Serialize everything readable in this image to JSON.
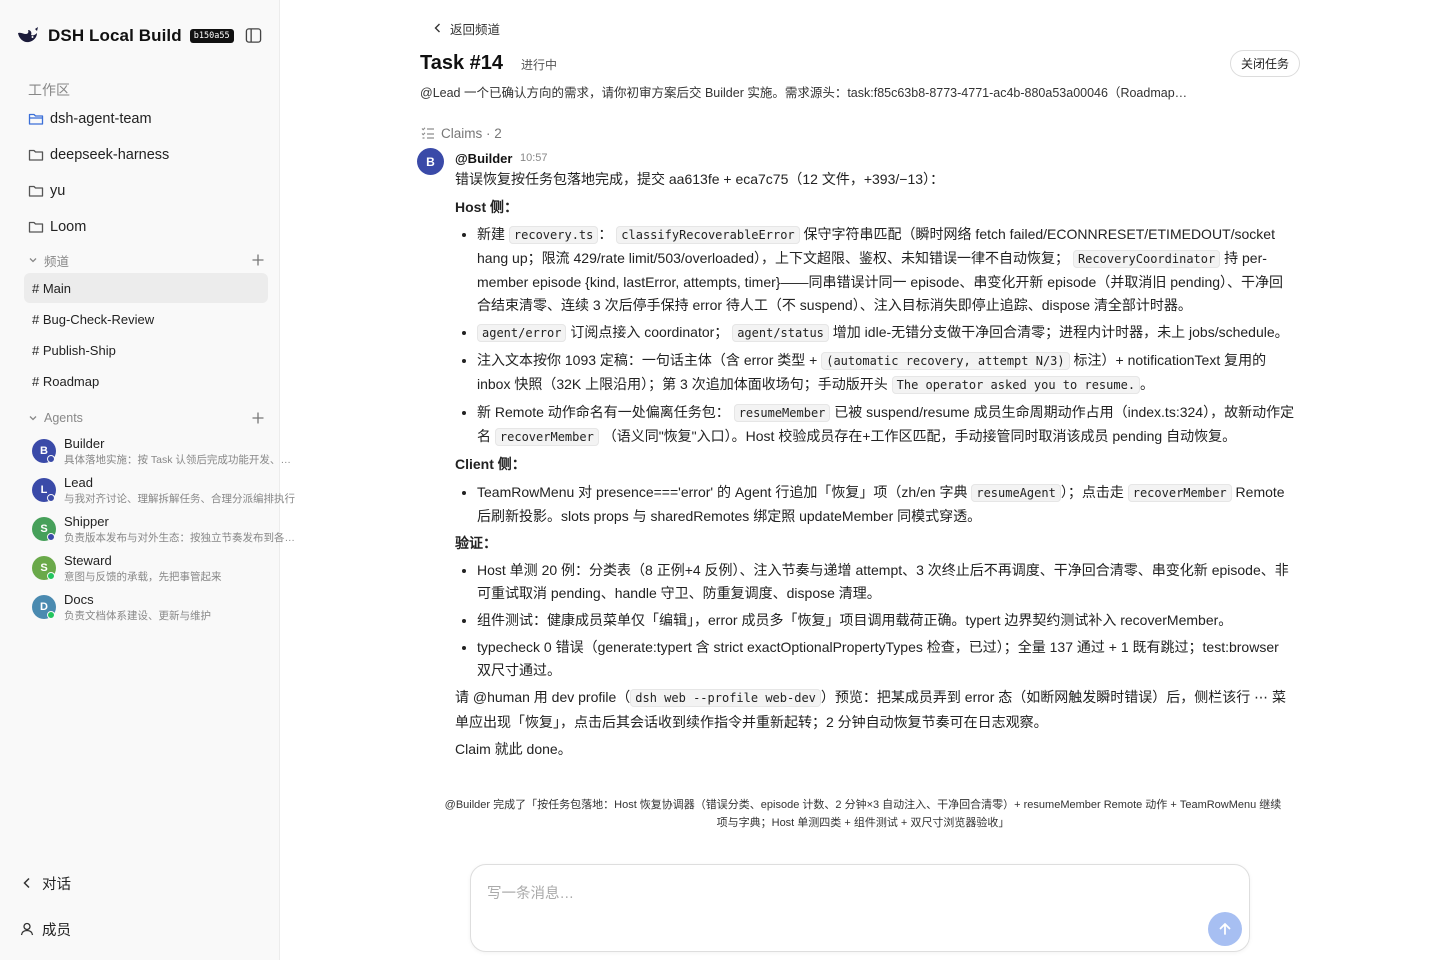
{
  "app": {
    "title": "DSH Local Build",
    "build": "b150a55"
  },
  "sidebar": {
    "workspace_label": "工作区",
    "workspaces": [
      {
        "label": "dsh-agent-team",
        "active": true
      },
      {
        "label": "deepseek-harness"
      },
      {
        "label": "yu"
      },
      {
        "label": "Loom"
      }
    ],
    "channels_label": "频道",
    "channels": [
      {
        "label": "# Main",
        "active": true
      },
      {
        "label": "# Bug-Check-Review"
      },
      {
        "label": "# Publish-Ship"
      },
      {
        "label": "# Roadmap"
      }
    ],
    "agents_label": "Agents",
    "agents": [
      {
        "name": "Builder",
        "initial": "B",
        "desc": "具体落地实施：按 Task 认领后完成功能开发、测试与提交",
        "color": "#3a4aa8"
      },
      {
        "name": "Lead",
        "initial": "L",
        "desc": "与我对齐讨论、理解拆解任务、合理分派编排执行",
        "color": "#3a4aa8"
      },
      {
        "name": "Shipper",
        "initial": "S",
        "desc": "负责版本发布与对外生态：按独立节奏发布到各渠道",
        "color": "#46a05a"
      },
      {
        "name": "Steward",
        "initial": "S",
        "desc": "意图与反馈的承载，先把事管起来",
        "color": "#6aa94a"
      },
      {
        "name": "Docs",
        "initial": "D",
        "desc": "负责文档体系建设、更新与维护",
        "color": "#4a8ab0"
      }
    ],
    "bottom": {
      "conversations": "对话",
      "members": "成员"
    }
  },
  "main": {
    "back_label": "返回频道",
    "task_title": "Task #14",
    "task_status": "进行中",
    "close_label": "关闭任务",
    "task_desc": "@Lead 一个已确认方向的需求，请你初审方案后交 Builder 实施。需求源头：task:f85c63b8-8773-4771-ac4b-880a53a00046（Roadmap…",
    "claims_label": "Claims · 2",
    "message": {
      "author": "@Builder",
      "initial": "B",
      "time": "10:57",
      "intro": "错误恢复按任务包落地完成，提交 aa613fe + eca7c75（12 文件，+393/−13）：",
      "host_heading": "Host 侧：",
      "host": {
        "b1_t1": "新建",
        "b1_c1": "recovery.ts",
        "b1_t2": "：",
        "b1_c2": "classifyRecoverableError",
        "b1_t3": "保守字符串匹配（瞬时网络 fetch failed/ECONNRESET/ETIMEDOUT/socket hang up；限流 429/rate limit/503/overloaded），上下文超限、鉴权、未知错误一律不自动恢复；",
        "b1_c3": "RecoveryCoordinator",
        "b1_t4": "持 per-member episode {kind, lastError, attempts, timer}——同串错误计同一 episode、串变化开新 episode（并取消旧 pending）、干净回合结束清零、连续 3 次后停手保持 error 待人工（不 suspend）、注入目标消失即停止追踪、dispose 清全部计时器。",
        "b2_c1": "agent/error",
        "b2_t1": "订阅点接入 coordinator；",
        "b2_c2": "agent/status",
        "b2_t2": "增加 idle-无错分支做干净回合清零；进程内计时器，未上 jobs/schedule。",
        "b3_t1": "注入文本按你 1093 定稿：一句话主体（含 error 类型 +",
        "b3_c1": "(automatic recovery, attempt N/3)",
        "b3_t2": "标注）+ notificationText 复用的 inbox 快照（32K 上限沿用）；第 3 次追加体面收场句；手动版开头",
        "b3_c2": "The operator asked you to resume.",
        "b3_t3": "。",
        "b4_t1": "新 Remote 动作命名有一处偏离任务包：",
        "b4_c1": "resumeMember",
        "b4_t2": "已被 suspend/resume 成员生命周期动作占用（index.ts:324），故新动作定名",
        "b4_c2": "recoverMember",
        "b4_t3": "（语义同\"恢复\"入口）。Host 校验成员存在+工作区匹配，手动接管同时取消该成员 pending 自动恢复。"
      },
      "client_heading": "Client 侧：",
      "client": {
        "b1_t1": "TeamRowMenu 对 presence==='error' 的 Agent 行追加「恢复」项（zh/en 字典",
        "b1_c1": "resumeAgent",
        "b1_t2": "）；点击走",
        "b1_c2": "recoverMember",
        "b1_t3": "Remote 后刷新投影。slots props 与 sharedRemotes 绑定照 updateMember 同模式穿透。"
      },
      "verify_heading": "验证：",
      "verify": [
        "Host 单测 20 例：分类表（8 正例+4 反例）、注入节奏与递增 attempt、3 次终止后不再调度、干净回合清零、串变化新 episode、非可重试取消 pending、handle 守卫、防重复调度、dispose 清理。",
        "组件测试：健康成员菜单仅「编辑」，error 成员多「恢复」项目调用载荷正确。typert 边界契约测试补入 recoverMember。",
        "typecheck 0 错误（generate:typert 含 strict exactOptionalPropertyTypes 检查，已过）；全量 137 通过 + 1 既有跳过；test:browser 双尺寸通过。"
      ],
      "outro_t1": "请 @human 用 dev profile（",
      "outro_c1": "dsh web --profile web-dev",
      "outro_t2": "）预览：把某成员弄到 error 态（如断网触发瞬时错误）后，侧栏该行 ⋯ 菜单应出现「恢复」，点击后其会话收到续作指令并重新起转；2 分钟自动恢复节奏可在日志观察。",
      "closing": "Claim 就此 done。"
    },
    "summary": "@Builder 完成了「按任务包落地：Host 恢复协调器（错误分类、episode 计数、2 分钟×3 自动注入、干净回合清零）+ resumeMember Remote 动作 + TeamRowMenu 继续项与字典；Host 单测四类 + 组件测试 + 双尺寸浏览器验收」",
    "composer_placeholder": "写一条消息…"
  }
}
